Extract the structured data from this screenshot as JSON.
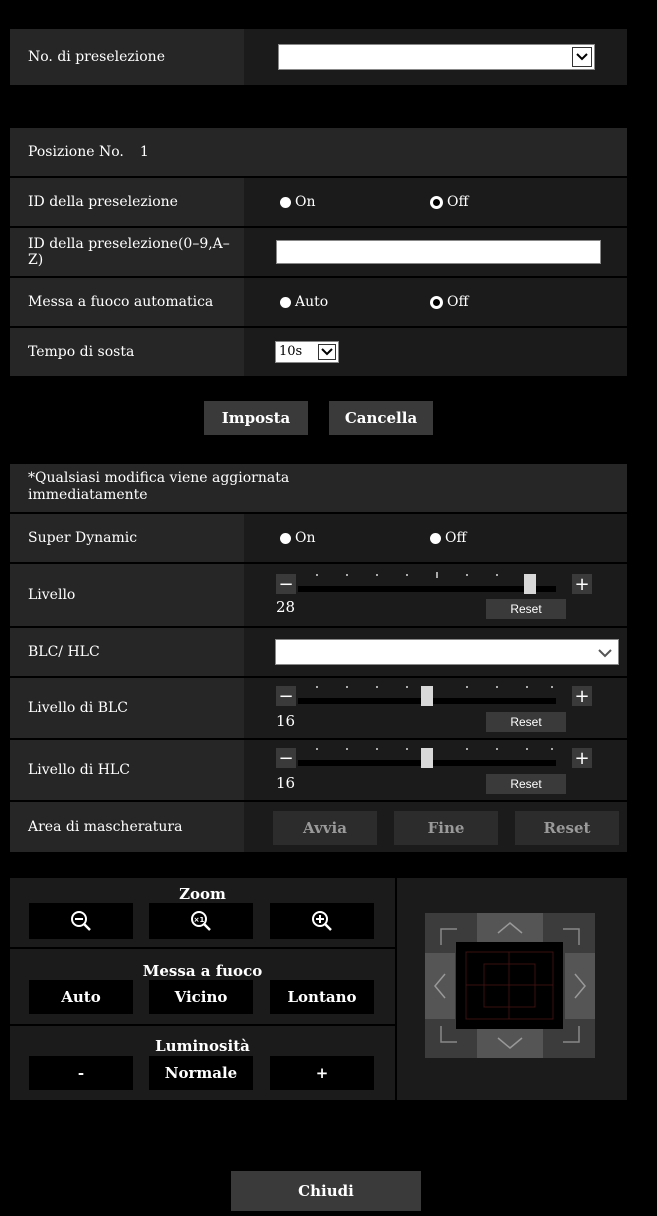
{
  "preset_number": {
    "label": "No. di preselezione",
    "value": ""
  },
  "position": {
    "label": "Posizione No.",
    "number": "1"
  },
  "preset_id": {
    "label": "ID della preselezione",
    "on": "On",
    "off": "Off",
    "selected": "Off"
  },
  "preset_id_text": {
    "label": "ID della preselezione(0–9,A–Z)",
    "value": ""
  },
  "autofocus": {
    "label": "Messa a fuoco automatica",
    "auto": "Auto",
    "off": "Off",
    "selected": "Off"
  },
  "dwell": {
    "label": "Tempo di sosta",
    "value": "10s"
  },
  "buttons": {
    "set": "Imposta",
    "cancel": "Cancella"
  },
  "notice": "*Qualsiasi modifica viene aggiornata immediatamente",
  "super_dynamic": {
    "label": "Super Dynamic",
    "on": "On",
    "off": "Off",
    "selected": "none"
  },
  "level": {
    "label": "Livello",
    "value": "28",
    "fraction": 0.9,
    "reset": "Reset",
    "minus": "−",
    "plus": "+"
  },
  "blc_hlc": {
    "label": "BLC/ HLC",
    "value": ""
  },
  "blc_level": {
    "label": "Livello di BLC",
    "value": "16",
    "fraction": 0.5,
    "reset": "Reset"
  },
  "hlc_level": {
    "label": "Livello di HLC",
    "value": "16",
    "fraction": 0.5,
    "reset": "Reset"
  },
  "mask_area": {
    "label": "Area di mascheratura",
    "start": "Avvia",
    "end": "Fine",
    "reset": "Reset"
  },
  "zoom": {
    "title": "Zoom"
  },
  "focus": {
    "title": "Messa a fuoco",
    "auto": "Auto",
    "near": "Vicino",
    "far": "Lontano"
  },
  "brightness": {
    "title": "Luminosità",
    "minus": "-",
    "normal": "Normale",
    "plus": "+"
  },
  "close": "Chiudi"
}
